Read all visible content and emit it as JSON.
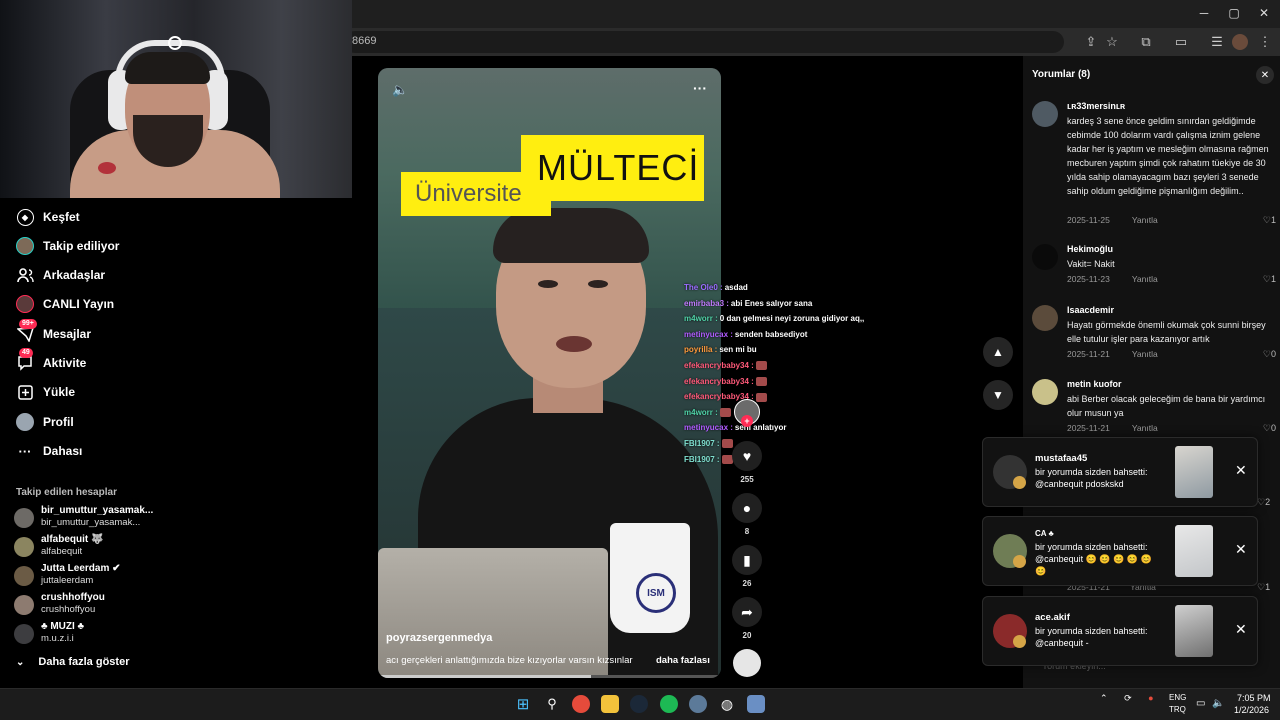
{
  "browser": {
    "url": "8669",
    "window_controls": [
      "─",
      "▢",
      "✕"
    ],
    "toolbar_icons": [
      "⇪",
      "☆",
      "⧉",
      "▭",
      "☰",
      "⋮"
    ]
  },
  "webcam": {
    "label": "webcam-feed"
  },
  "sidebar": {
    "nav": [
      {
        "label": "Keşfet",
        "icon": "compass-icon"
      },
      {
        "label": "Takip ediliyor",
        "icon": "following-avatar-icon"
      },
      {
        "label": "Arkadaşlar",
        "icon": "friends-icon"
      },
      {
        "label": "CANLI Yayın",
        "icon": "live-icon"
      },
      {
        "label": "Mesajlar",
        "icon": "messages-icon",
        "badge": "99+"
      },
      {
        "label": "Aktivite",
        "icon": "activity-icon",
        "badge": "49"
      },
      {
        "label": "Yükle",
        "icon": "upload-icon"
      },
      {
        "label": "Profil",
        "icon": "profile-icon"
      },
      {
        "label": "Dahası",
        "icon": "more-icon"
      }
    ],
    "following_title": "Takip edilen hesaplar",
    "following": [
      {
        "name": "bir_umuttur_yasamak...",
        "handle": "bir_umuttur_yasamak..."
      },
      {
        "name": "alfabequit 🐺",
        "handle": "alfabequit"
      },
      {
        "name": "Jutta Leerdam ✔",
        "handle": "juttaleerdam"
      },
      {
        "name": "crushhoffyou",
        "handle": "crushhoffyou"
      },
      {
        "name": "♣ MUZI ♣",
        "handle": "m.u.z.i.i"
      }
    ],
    "more_label": "Daha fazla göster"
  },
  "video": {
    "text_big": "MÜLTECİ",
    "text_small": "Üniversite li",
    "author": "poyrazsergenmedya",
    "description": "acı gerçekleri anlattığımızda bize kızıyorlar varsın kızsınlar",
    "more": "daha fazlası",
    "mug_logo": "ISM",
    "progress": 0.62
  },
  "chat": [
    {
      "user": "The Ole0",
      "color": "#9b6bff",
      "msg": "asdad"
    },
    {
      "user": "emirbaba3",
      "color": "#c27bff",
      "msg": "abi Enes salıyor sana"
    },
    {
      "user": "m4worr",
      "color": "#4fd1a6",
      "msg": "0 dan gelmesi neyi zoruna gidiyor aq,,"
    },
    {
      "user": "metinyucax",
      "color": "#b05bff",
      "msg": "senden babsediyot"
    },
    {
      "user": "poyrilla",
      "color": "#ff9a3c",
      "msg": "sen mi bu"
    },
    {
      "user": "efekancrybaby34",
      "color": "#ff5a7a",
      "msg": "",
      "emote": true
    },
    {
      "user": "efekancrybaby34",
      "color": "#ff5a7a",
      "msg": "",
      "emote": true
    },
    {
      "user": "efekancrybaby34",
      "color": "#ff5a7a",
      "msg": "",
      "emote": true
    },
    {
      "user": "m4worr",
      "color": "#4fd1a6",
      "msg": "",
      "emote": true
    },
    {
      "user": "metinyucax",
      "color": "#b05bff",
      "msg": "seni anlatıyor"
    },
    {
      "user": "FBI1907",
      "color": "#7fe0d0",
      "msg": "",
      "emote": true
    },
    {
      "user": "FBI1907",
      "color": "#7fe0d0",
      "msg": "",
      "emote": true
    }
  ],
  "actions": {
    "likes": "255",
    "comments": "8",
    "saves": "26",
    "shares": "20"
  },
  "comments": {
    "title": "Yorumlar (8)",
    "reply_label": "Yanıtla",
    "items": [
      {
        "user": "ʟʀ33mersinʟʀ",
        "text": "kardeş 3 sene önce geldim sınırdan geldiğimde cebimde 100 dolarım vardı çalışma iznim gelene kadar her iş yaptım ve mesleğim olmasına rağmen mecburen yaptım şimdi çok rahatım tüekiye de 30 yılda sahip olamayacagım bazı şeyleri 3 senede sahip oldum geldiğime pişmanlığım değilim..",
        "date": "2025-11-25",
        "likes": "1"
      },
      {
        "user": "Hekimoğlu",
        "text": "Vakit= Nakit",
        "date": "2025-11-23",
        "likes": "1"
      },
      {
        "user": "Isaacdemir",
        "text": "Hayatı görmekde önemli okumak çok sunni birşey elle tutulur işler para kazanıyor artık",
        "date": "2025-11-21",
        "likes": "0"
      },
      {
        "user": "metin kuofor",
        "text": "abi Berber olacak geleceğim de bana bir yardımcı olur musun ya",
        "date": "2025-11-21",
        "likes": "0"
      }
    ],
    "hidden_likes": [
      "2",
      "1"
    ],
    "hidden_date": "2025-11-21",
    "input_placeholder": "Yorum ekleyin..."
  },
  "notifications": [
    {
      "user": "mustafaa45",
      "text": "bir yorumda sizden bahsetti: @canbequit pdoskskd"
    },
    {
      "user": "CA ♣",
      "text": "bir yorumda sizden bahsetti: @canbequit 😊 😊 😊 😊 😊 😊"
    },
    {
      "user": "ace.akif",
      "text": "bir yorumda sizden bahsetti: @canbequit -"
    }
  ],
  "taskbar": {
    "lang_1": "ENG",
    "lang_2": "TRQ",
    "time": "7:05 PM",
    "date": "1/2/2026"
  },
  "colors": {
    "accent": "#ff2c55",
    "yellow": "#ffee10",
    "panel": "#121212"
  }
}
